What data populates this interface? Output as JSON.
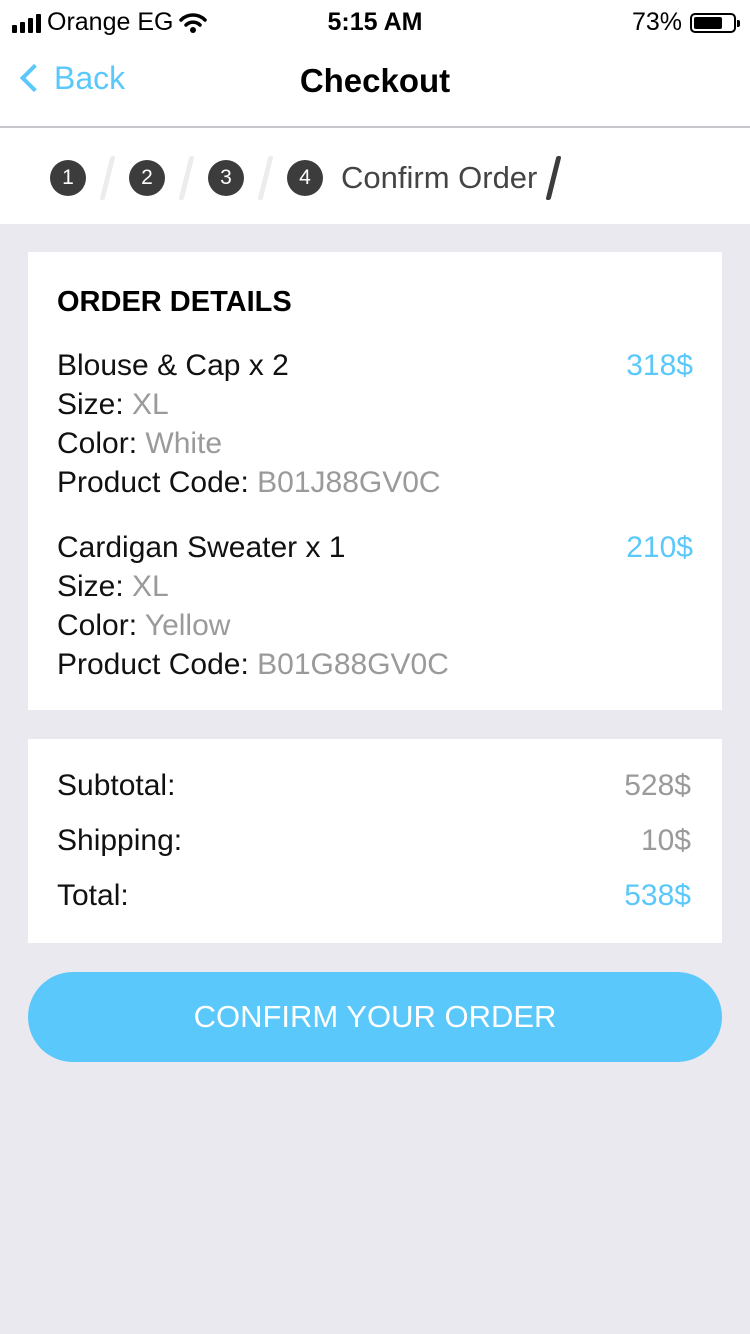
{
  "status_bar": {
    "carrier": "Orange EG",
    "time": "5:15 AM",
    "battery": "73%",
    "battery_level": 0.73
  },
  "nav": {
    "back_label": "Back",
    "title": "Checkout"
  },
  "stepper": {
    "steps": [
      "1",
      "2",
      "3",
      "4"
    ],
    "current_label": "Confirm Order"
  },
  "order": {
    "title": "ORDER DETAILS",
    "size_label": "Size:",
    "color_label": "Color:",
    "code_label": "Product Code:",
    "items": [
      {
        "name": "Blouse & Cap x 2",
        "price": "318$",
        "size": "XL",
        "color": "White",
        "code": "B01J88GV0C"
      },
      {
        "name": "Cardigan Sweater x 1",
        "price": "210$",
        "size": "XL",
        "color": "Yellow",
        "code": "B01G88GV0C"
      }
    ]
  },
  "totals": {
    "subtotal_label": "Subtotal:",
    "subtotal": "528$",
    "shipping_label": "Shipping:",
    "shipping": "10$",
    "total_label": "Total:",
    "total": "538$"
  },
  "confirm_label": "CONFIRM YOUR ORDER",
  "colors": {
    "accent": "#5ac8fa",
    "background": "#e9e9ef",
    "step_dark": "#3c3c3c"
  }
}
